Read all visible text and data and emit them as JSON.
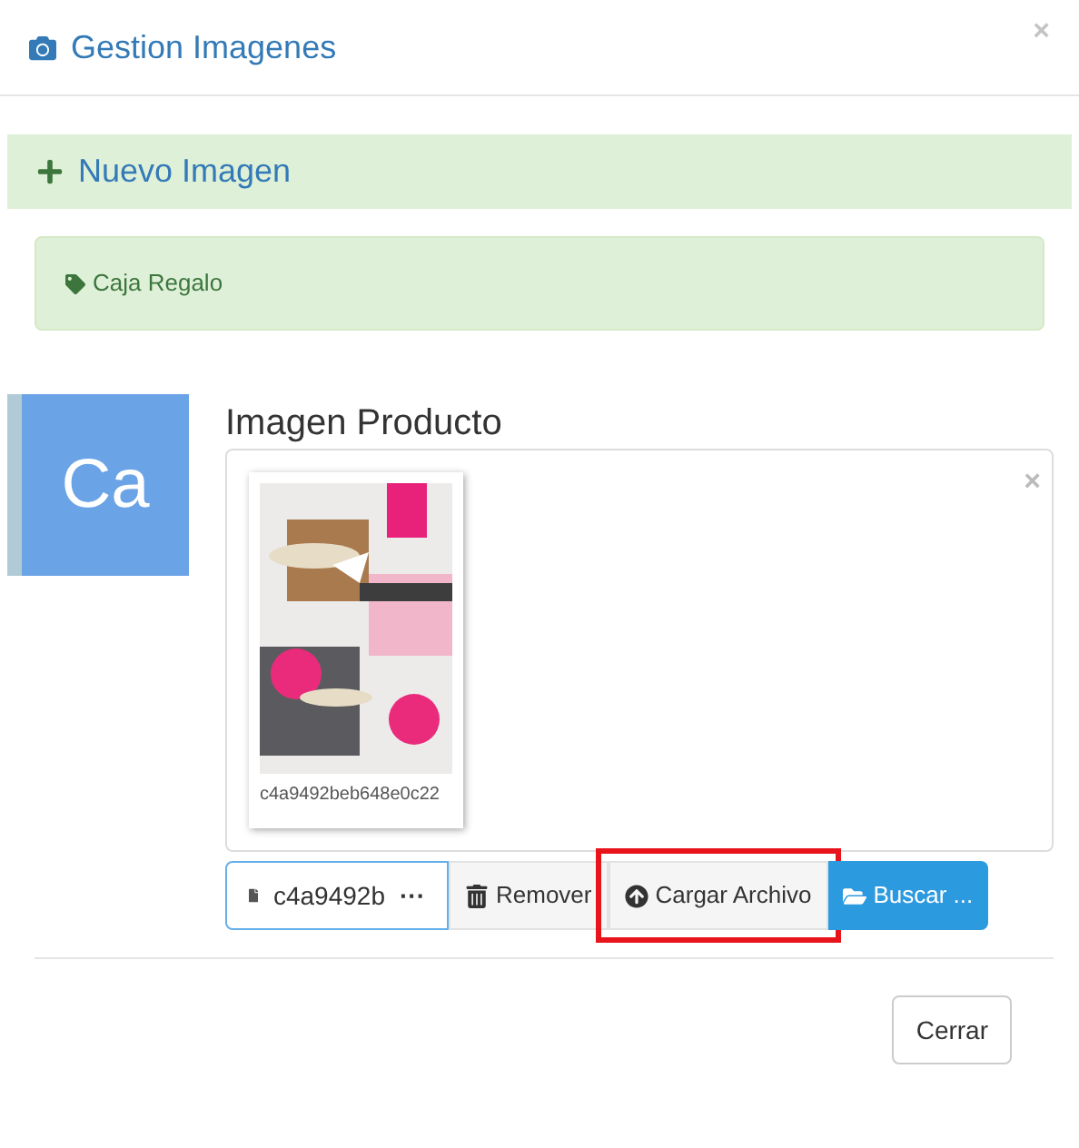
{
  "modal": {
    "title": "Gestion Imagenes",
    "close": "×"
  },
  "section": {
    "title": "Nuevo Imagen"
  },
  "alert": {
    "text": "Caja Regalo"
  },
  "avatar": {
    "text": "Ca"
  },
  "field": {
    "label": "Imagen Producto",
    "clear": "×",
    "preview": {
      "caption": "c4a9492beb648e0c22"
    },
    "filename": "c4a9492b",
    "ellipsis": "···"
  },
  "actions": [
    {
      "kind": "remove",
      "label": "Remover",
      "highlighted": false
    },
    {
      "kind": "upload",
      "label": "Cargar Archivo",
      "highlighted": true
    },
    {
      "kind": "browse",
      "label": "Buscar ...",
      "highlighted": false
    }
  ],
  "footer": {
    "button": "Cerrar"
  }
}
